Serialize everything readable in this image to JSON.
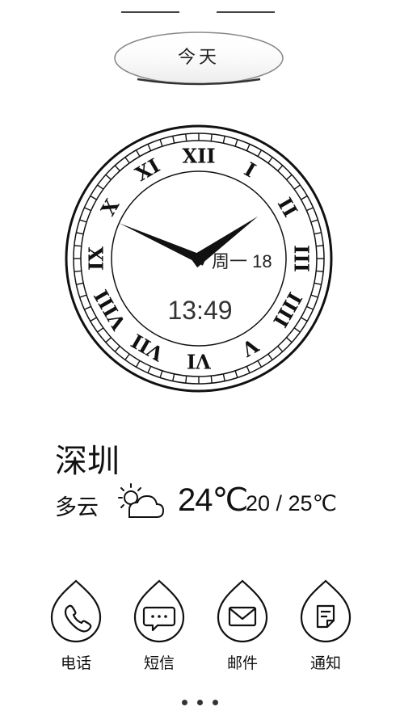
{
  "today_tab": {
    "label": "今天"
  },
  "clock": {
    "date": "周一 18",
    "time": "13:49",
    "numerals": [
      "XII",
      "I",
      "II",
      "III",
      "IIII",
      "V",
      "VI",
      "VII",
      "VIII",
      "IX",
      "X",
      "XI"
    ]
  },
  "weather": {
    "city": "深圳",
    "condition": "多云",
    "icon": "partly-cloudy-icon",
    "temp_now": "24℃",
    "temp_range": "20 / 25℃"
  },
  "dock": [
    {
      "label": "电话",
      "icon": "phone-icon"
    },
    {
      "label": "短信",
      "icon": "message-icon"
    },
    {
      "label": "邮件",
      "icon": "mail-icon"
    },
    {
      "label": "通知",
      "icon": "notification-icon"
    }
  ],
  "pager": {
    "pages": 3
  }
}
